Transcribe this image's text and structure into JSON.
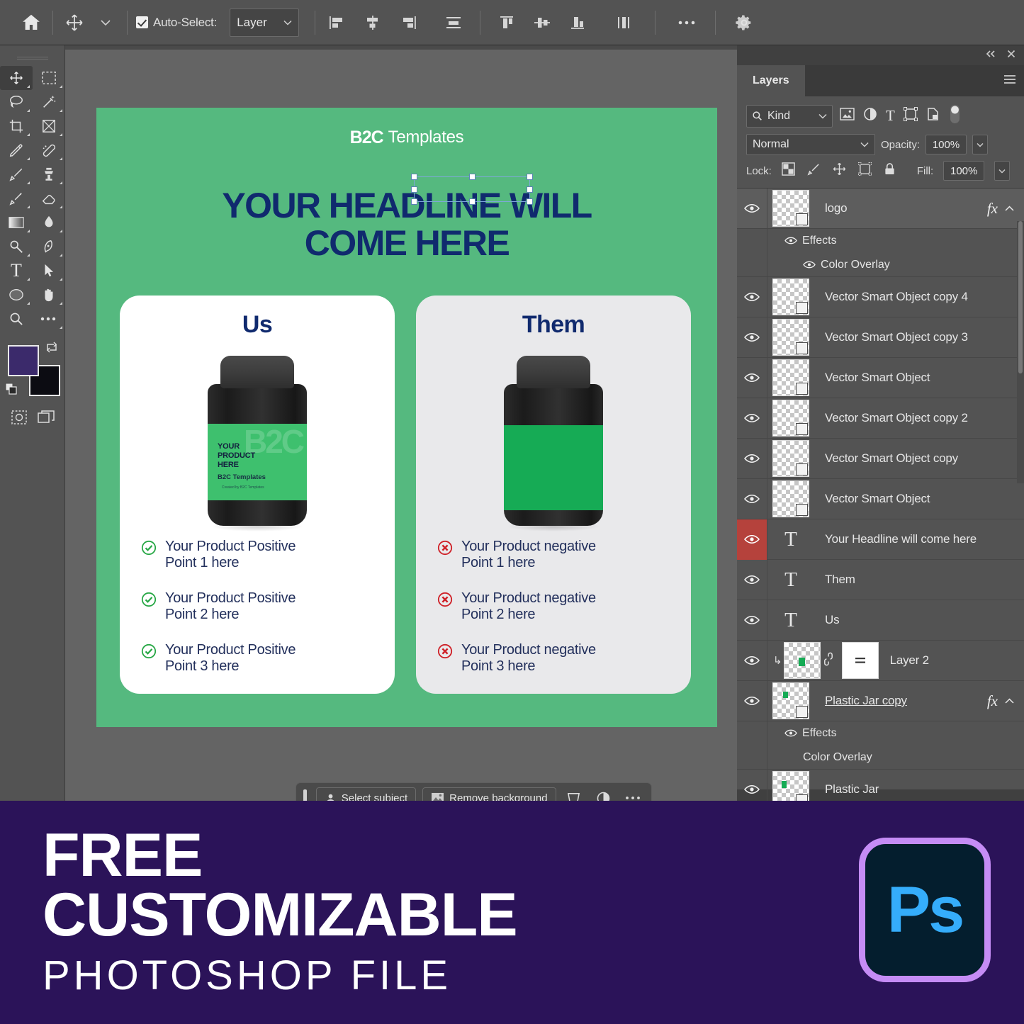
{
  "options_bar": {
    "home_icon": "home-icon",
    "move_tool_icon": "move-tool-icon",
    "auto_select_label": "Auto-Select:",
    "auto_select_checked": true,
    "layer_select_value": "Layer",
    "align_icons": [
      "align-left-edges-icon",
      "align-horizontal-centers-icon",
      "align-right-edges-icon",
      "distribute-horizontal-icon",
      "align-top-edges-icon",
      "align-vertical-centers-icon",
      "align-bottom-edges-icon",
      "distribute-vertical-icon"
    ],
    "more_icon": "more-options-icon",
    "settings_icon": "gear-icon"
  },
  "toolbar": {
    "tools": [
      "move-tool-icon",
      "marquee-tool-icon",
      "lasso-tool-icon",
      "magic-wand-tool-icon",
      "crop-tool-icon",
      "frame-tool-icon",
      "eyedropper-tool-icon",
      "healing-brush-tool-icon",
      "brush-tool-icon",
      "clone-stamp-tool-icon",
      "history-brush-tool-icon",
      "eraser-tool-icon",
      "gradient-tool-icon",
      "blur-tool-icon",
      "dodge-tool-icon",
      "pen-tool-icon",
      "type-tool-icon",
      "path-selection-tool-icon",
      "shape-tool-icon",
      "hand-tool-icon",
      "zoom-tool-icon",
      "edit-toolbar-icon"
    ],
    "active_tool": "move-tool-icon",
    "foreground_color": "#3b2a6b",
    "background_color": "#0c0c12",
    "swap_colors_icon": "swap-colors-icon",
    "default_colors_icon": "default-colors-icon",
    "quick_mask_icon": "quick-mask-icon",
    "screen_mode_icon": "screen-mode-icon"
  },
  "canvas": {
    "background_color": "#55b97f",
    "logo_mark": "B2C",
    "logo_text": "Templates",
    "headline_line1": "YOUR HEADLINE WILL",
    "headline_line2": "COME HERE",
    "headline_color": "#102a6e",
    "cards": [
      {
        "side": "us",
        "title": "Us",
        "background_color": "#ffffff",
        "jar_label_color": "#3ec06e",
        "jar_label_line1": "YOUR",
        "jar_label_line2": "PRODUCT",
        "jar_label_line3": "HERE",
        "jar_brand": "B2C Templates",
        "jar_credit": "Created by B2C Templates",
        "jar_ghost": "B2C",
        "bullet_icon": "check-circle-icon",
        "bullet_icon_color": "#27a745",
        "bullets": [
          {
            "line1": "Your Product Positive",
            "line2": "Point 1 here"
          },
          {
            "line1": "Your Product Positive",
            "line2": "Point 2 here"
          },
          {
            "line1": "Your Product Positive",
            "line2": "Point 3 here"
          }
        ]
      },
      {
        "side": "them",
        "title": "Them",
        "background_color": "#e9e9eb",
        "jar_label_color": "#16ab55",
        "bullet_icon": "x-circle-icon",
        "bullet_icon_color": "#cf2027",
        "bullets": [
          {
            "line1": "Your Product negative",
            "line2": "Point 1 here"
          },
          {
            "line1": "Your Product negative",
            "line2": "Point 2 here"
          },
          {
            "line1": "Your Product negative",
            "line2": "Point 3 here"
          }
        ]
      }
    ]
  },
  "context_bar": {
    "grip_icon": "drag-grip-icon",
    "select_subject_label": "Select subject",
    "select_subject_icon": "select-subject-icon",
    "remove_background_label": "Remove background",
    "remove_background_icon": "remove-background-icon",
    "transform_icon": "transform-icon",
    "adjustment_icon": "adjustment-icon",
    "more_icon": "more-options-icon"
  },
  "panel": {
    "collapse_icon": "collapse-panel-icon",
    "close_icon": "close-icon",
    "tab_label": "Layers",
    "menu_icon": "panel-menu-icon",
    "filter": {
      "search_icon": "search-icon",
      "kind_label": "Kind",
      "chevron_icon": "chevron-down-icon",
      "type_filters": [
        "pixel-layer-filter-icon",
        "adjustment-layer-filter-icon",
        "type-layer-filter-icon",
        "shape-layer-filter-icon",
        "smart-object-filter-icon"
      ],
      "toggle_icon": "filter-toggle-icon"
    },
    "blend_mode": "Normal",
    "opacity_label": "Opacity:",
    "opacity_value": "100%",
    "lock_label": "Lock:",
    "lock_icons": [
      "lock-transparent-pixels-icon",
      "lock-image-pixels-icon",
      "lock-position-icon",
      "lock-artboard-nesting-icon",
      "lock-all-icon"
    ],
    "fill_label": "Fill:",
    "fill_value": "100%",
    "layers": [
      {
        "name": "logo",
        "type": "smart-object",
        "visible": true,
        "selected": true,
        "has_fx": true,
        "effects_label": "Effects",
        "effect_items": [
          "Color Overlay"
        ]
      },
      {
        "name": "Vector Smart Object copy 4",
        "type": "smart-object",
        "visible": true,
        "selected": false,
        "has_fx": false
      },
      {
        "name": "Vector Smart Object copy 3",
        "type": "smart-object",
        "visible": true,
        "selected": false,
        "has_fx": false
      },
      {
        "name": "Vector Smart Object",
        "type": "smart-object",
        "visible": true,
        "selected": false,
        "has_fx": false
      },
      {
        "name": "Vector Smart Object copy 2",
        "type": "smart-object",
        "visible": true,
        "selected": false,
        "has_fx": false
      },
      {
        "name": "Vector Smart Object copy",
        "type": "smart-object",
        "visible": true,
        "selected": false,
        "has_fx": false
      },
      {
        "name": "Vector Smart Object",
        "type": "smart-object",
        "visible": true,
        "selected": false,
        "has_fx": false
      },
      {
        "name": "Your Headline will come here",
        "type": "text",
        "visible": true,
        "selected": false,
        "eye_highlight": true,
        "has_fx": false
      },
      {
        "name": "Them",
        "type": "text",
        "visible": true,
        "selected": false,
        "has_fx": false
      },
      {
        "name": "Us",
        "type": "text",
        "visible": true,
        "selected": false,
        "has_fx": false
      },
      {
        "name": "Layer 2",
        "type": "masked-clipped",
        "visible": true,
        "selected": false,
        "has_fx": false
      },
      {
        "name": "Plastic Jar copy",
        "type": "smart-object",
        "visible": true,
        "selected": false,
        "has_fx": true,
        "editing": true,
        "effects_label": "Effects",
        "effect_items": [
          "Color Overlay"
        ]
      },
      {
        "name": "Plastic Jar",
        "type": "smart-object",
        "visible": true,
        "selected": false,
        "has_fx": false
      }
    ]
  },
  "banner": {
    "line1": "FREE",
    "line2": "CUSTOMIZABLE",
    "line3": "PHOTOSHOP FILE",
    "background_color": "#2b1359",
    "logo_text": "Ps",
    "logo_border_color": "#c58cf5",
    "logo_text_color": "#35adfb"
  }
}
